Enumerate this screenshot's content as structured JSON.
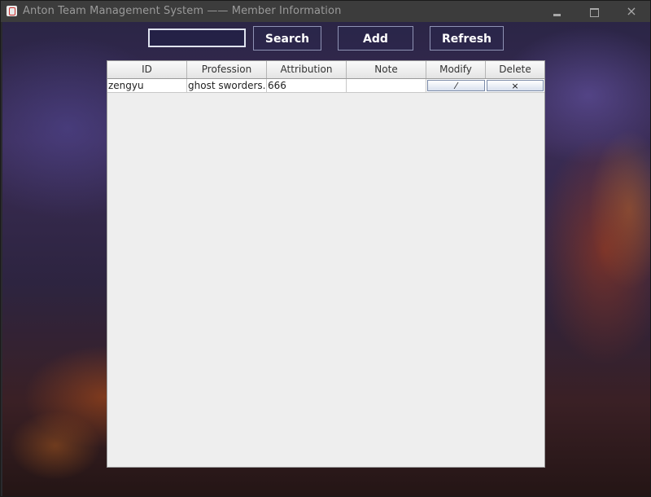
{
  "window": {
    "title": "Anton Team Management System —— Member Information",
    "controls": {
      "minimize": "minimize",
      "maximize": "maximize",
      "close": "×"
    }
  },
  "toolbar": {
    "search_value": "",
    "search_label": "Search",
    "add_label": "Add",
    "refresh_label": "Refresh"
  },
  "table": {
    "columns": [
      "ID",
      "Profession",
      "Attribution",
      "Note",
      "Modify",
      "Delete"
    ],
    "rows": [
      {
        "id": "zengyu",
        "profession": "ghost sworders...",
        "attribution": "666",
        "note": "",
        "modify_icon": "⁄",
        "delete_icon": "×"
      }
    ]
  }
}
